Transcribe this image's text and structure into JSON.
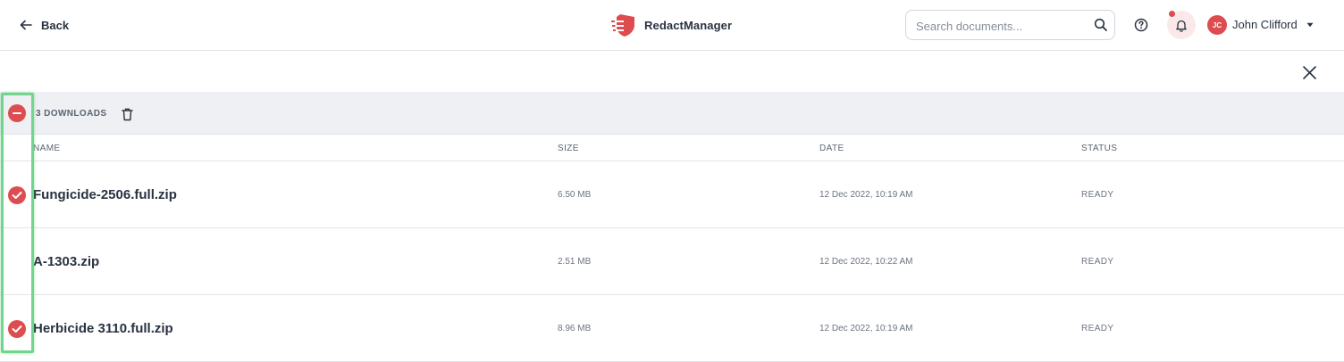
{
  "topbar": {
    "back_label": "Back",
    "brand_name": "RedactManager",
    "search_placeholder": "Search documents...",
    "user_initials": "JC",
    "user_name": "John Clifford"
  },
  "bulk": {
    "count_label": "3 DOWNLOADS"
  },
  "table": {
    "headers": {
      "name": "NAME",
      "size": "SIZE",
      "date": "DATE",
      "status": "STATUS"
    },
    "rows": [
      {
        "name": "Fungicide-2506.full.zip",
        "size": "6.50 MB",
        "date": "12 Dec 2022, 10:19 AM",
        "status": "READY",
        "selected": true
      },
      {
        "name": "A-1303.zip",
        "size": "2.51 MB",
        "date": "12 Dec 2022, 10:22 AM",
        "status": "READY",
        "selected": false
      },
      {
        "name": "Herbicide 3110.full.zip",
        "size": "8.96 MB",
        "date": "12 Dec 2022, 10:19 AM",
        "status": "READY",
        "selected": true
      }
    ]
  },
  "colors": {
    "accent": "#dd4d50",
    "highlight": "#6fd68c",
    "bulk_bar_bg": "#eef0f3",
    "text": "#283241"
  },
  "icons": {
    "back": "arrow-left-icon",
    "logo": "shield-logo-icon",
    "search": "search-icon",
    "help": "help-circle-icon",
    "notifications": "bell-icon",
    "user_menu": "caret-down-icon",
    "close": "close-icon",
    "delete": "trash-icon",
    "row_selected": "check-circle-icon",
    "bulk_toggle": "minus-circle-icon"
  }
}
